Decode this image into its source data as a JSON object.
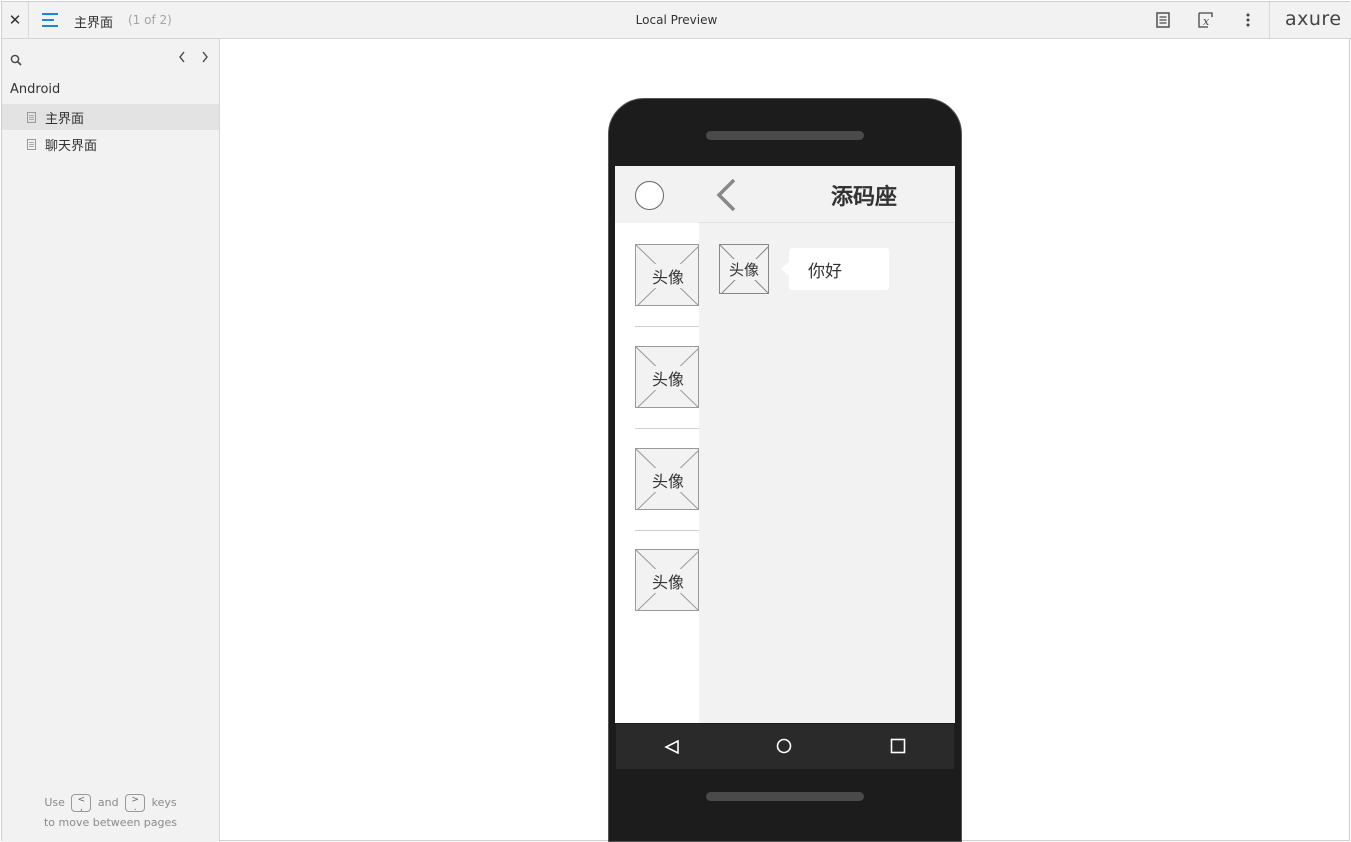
{
  "topbar": {
    "close_icon": "close-icon",
    "menu_icon": "sitemap-menu-icon",
    "page_name": "主界面",
    "page_count": "(1 of 2)",
    "title": "Local Preview",
    "notes_icon": "notes-icon",
    "variables_icon": "variables-icon",
    "more_icon": "more-vertical-icon",
    "logo": "axure"
  },
  "sidebar": {
    "search_icon": "search-icon",
    "folder": "Android",
    "items": [
      {
        "label": "主界面",
        "active": true
      },
      {
        "label": "聊天界面",
        "active": false
      }
    ],
    "hint_use": "Use",
    "hint_and": "and",
    "hint_keys": "keys",
    "hint_line2": "to move between pages",
    "key_prev": "<\n,",
    "key_next": ">\n."
  },
  "phone": {
    "list_avatars": [
      "头像",
      "头像",
      "头像",
      "头像"
    ],
    "chat_title": "添码座",
    "chat_avatar": "头像",
    "message": "你好",
    "nav_icons": [
      "back-triangle-icon",
      "home-circle-icon",
      "recents-square-icon"
    ]
  },
  "colors": {
    "accent": "#1e88d2",
    "toolbar_bg": "#f2f2f2",
    "phone_body": "#1c1c1c"
  }
}
